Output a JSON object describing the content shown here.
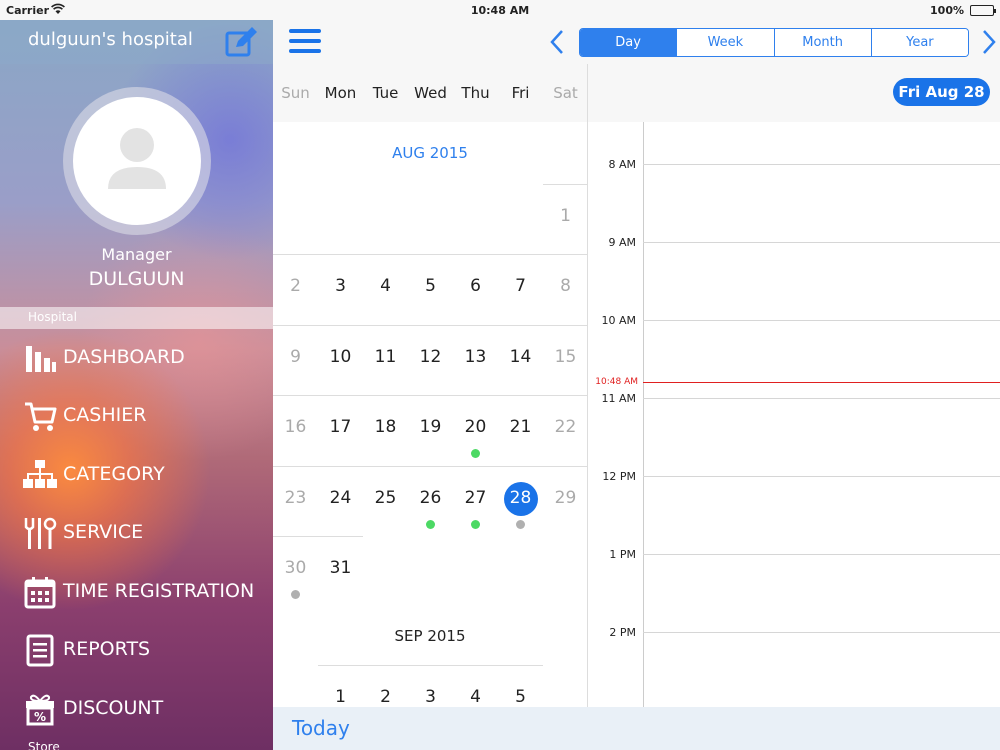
{
  "status_bar": {
    "carrier": "Carrier",
    "time": "10:48 AM",
    "battery": "100%"
  },
  "sidebar": {
    "hospital_name": "dulguun's hospital",
    "role": "Manager",
    "user_name": "DULGUUN",
    "section_label": "Hospital",
    "bottom_label": "Store",
    "items": [
      {
        "label": "DASHBOARD",
        "icon": "bar-chart-icon"
      },
      {
        "label": "CASHIER",
        "icon": "cart-icon"
      },
      {
        "label": "CATEGORY",
        "icon": "hierarchy-icon"
      },
      {
        "label": "SERVICE",
        "icon": "tools-icon"
      },
      {
        "label": "TIME REGISTRATION",
        "icon": "calendar-icon"
      },
      {
        "label": "REPORTS",
        "icon": "document-icon"
      },
      {
        "label": "DISCOUNT",
        "icon": "gift-percent-icon"
      }
    ]
  },
  "toolbar": {
    "view_modes": [
      "Day",
      "Week",
      "Month",
      "Year"
    ],
    "active_view": "Day"
  },
  "calendar": {
    "weekdays": [
      "Sun",
      "Mon",
      "Tue",
      "Wed",
      "Thu",
      "Fri",
      "Sat"
    ],
    "months": [
      {
        "title": "AUG 2015",
        "weeks": [
          [
            "",
            "",
            "",
            "",
            "",
            "",
            "1"
          ],
          [
            "2",
            "3",
            "4",
            "5",
            "6",
            "7",
            "8"
          ],
          [
            "9",
            "10",
            "11",
            "12",
            "13",
            "14",
            "15"
          ],
          [
            "16",
            "17",
            "18",
            "19",
            "20",
            "21",
            "22"
          ],
          [
            "23",
            "24",
            "25",
            "26",
            "27",
            "28",
            "29"
          ],
          [
            "30",
            "31",
            "",
            "",
            "",
            "",
            ""
          ]
        ],
        "selected": "28",
        "dots": [
          {
            "day": "20",
            "color": "green"
          },
          {
            "day": "26",
            "color": "green"
          },
          {
            "day": "27",
            "color": "green"
          },
          {
            "day": "28",
            "color": "gray"
          },
          {
            "day": "30",
            "color": "gray"
          }
        ]
      },
      {
        "title": "SEP 2015",
        "weeks": [
          [
            "",
            "1",
            "2",
            "3",
            "4",
            "5",
            ""
          ]
        ]
      }
    ],
    "today_label": "Today"
  },
  "day_view": {
    "date_label": "Fri Aug 28",
    "hours": [
      "8 AM",
      "9 AM",
      "10 AM",
      "11 AM",
      "12 PM",
      "1 PM",
      "2 PM"
    ],
    "now_label": "10:48 AM",
    "now_hour_fraction": 2.8
  }
}
